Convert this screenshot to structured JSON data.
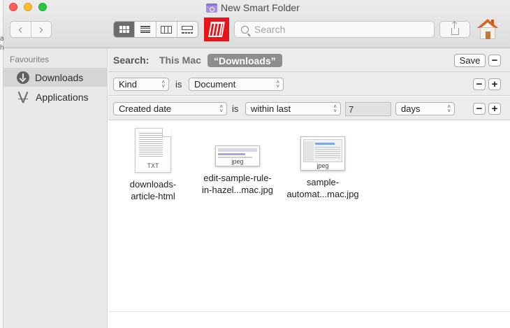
{
  "window": {
    "title": "New Smart Folder",
    "edge_fragments": [
      "a",
      "h"
    ]
  },
  "toolbar": {
    "back_icon": "chevron-left-icon",
    "forward_icon": "chevron-right-icon",
    "view_modes": [
      "icon-view",
      "list-view",
      "column-view",
      "gallery-view"
    ],
    "active_view": "icon-view",
    "search_placeholder": "Search",
    "search_value": "",
    "hazel_color": "#e8141b"
  },
  "sidebar": {
    "section": "Favourites",
    "items": [
      {
        "label": "Downloads",
        "icon": "download-icon",
        "selected": true
      },
      {
        "label": "Applications",
        "icon": "applications-icon",
        "selected": false
      }
    ]
  },
  "search_scope": {
    "label": "Search:",
    "this_mac": "This Mac",
    "current": "“Downloads”",
    "save": "Save"
  },
  "rules": [
    {
      "attribute": "Kind",
      "operator": "is",
      "value": "Document"
    },
    {
      "attribute": "Created date",
      "operator": "is",
      "qualifier": "within last",
      "amount": "7",
      "unit": "days"
    }
  ],
  "files": [
    {
      "name_line1": "downloads-",
      "name_line2": "article-html",
      "type": "TXT"
    },
    {
      "name_line1": "edit-sample-rule-",
      "name_line2": "in-hazel...mac.jpg",
      "type": "jpeg"
    },
    {
      "name_line1": "sample-",
      "name_line2": "automat...mac.jpg",
      "type": "jpeg"
    }
  ]
}
